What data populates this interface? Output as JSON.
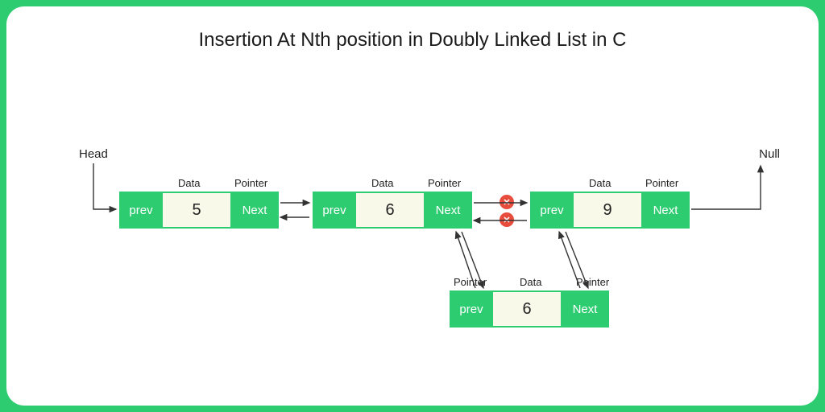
{
  "title": "Insertion At Nth position in Doubly Linked List in C",
  "labels": {
    "head": "Head",
    "null": "Null",
    "data": "Data",
    "pointer": "Pointer",
    "prev": "prev",
    "next": "Next"
  },
  "nodes": {
    "n1": {
      "value": "5"
    },
    "n2": {
      "value": "6"
    },
    "n3": {
      "value": "9"
    },
    "newNode": {
      "value": "6"
    }
  },
  "chart_data": {
    "type": "diagram",
    "title": "Insertion At Nth position in Doubly Linked List in C",
    "structure": "doubly-linked-list",
    "head_label": "Head",
    "tail_label": "Null",
    "existing_nodes": [
      {
        "prev_label": "prev",
        "data": 5,
        "next_label": "Next"
      },
      {
        "prev_label": "prev",
        "data": 6,
        "next_label": "Next"
      },
      {
        "prev_label": "prev",
        "data": 9,
        "next_label": "Next"
      }
    ],
    "inserted_node": {
      "prev_label": "prev",
      "data": 6,
      "next_label": "Next",
      "insert_between_indices": [
        1,
        2
      ]
    },
    "broken_links": [
      {
        "from_index": 1,
        "to_index": 2,
        "direction": "next",
        "marker": "x"
      },
      {
        "from_index": 2,
        "to_index": 1,
        "direction": "prev",
        "marker": "x"
      }
    ],
    "new_links": [
      {
        "from": "existing[1].next",
        "to": "inserted.prev"
      },
      {
        "from": "inserted.next",
        "to": "existing[2].prev"
      }
    ],
    "field_headers": [
      "Data",
      "Pointer"
    ],
    "colors": {
      "fill_ptr": "#2ecc71",
      "fill_data": "#f8f9e8",
      "border": "#2ecc71",
      "cross": "#e74c3c"
    }
  }
}
